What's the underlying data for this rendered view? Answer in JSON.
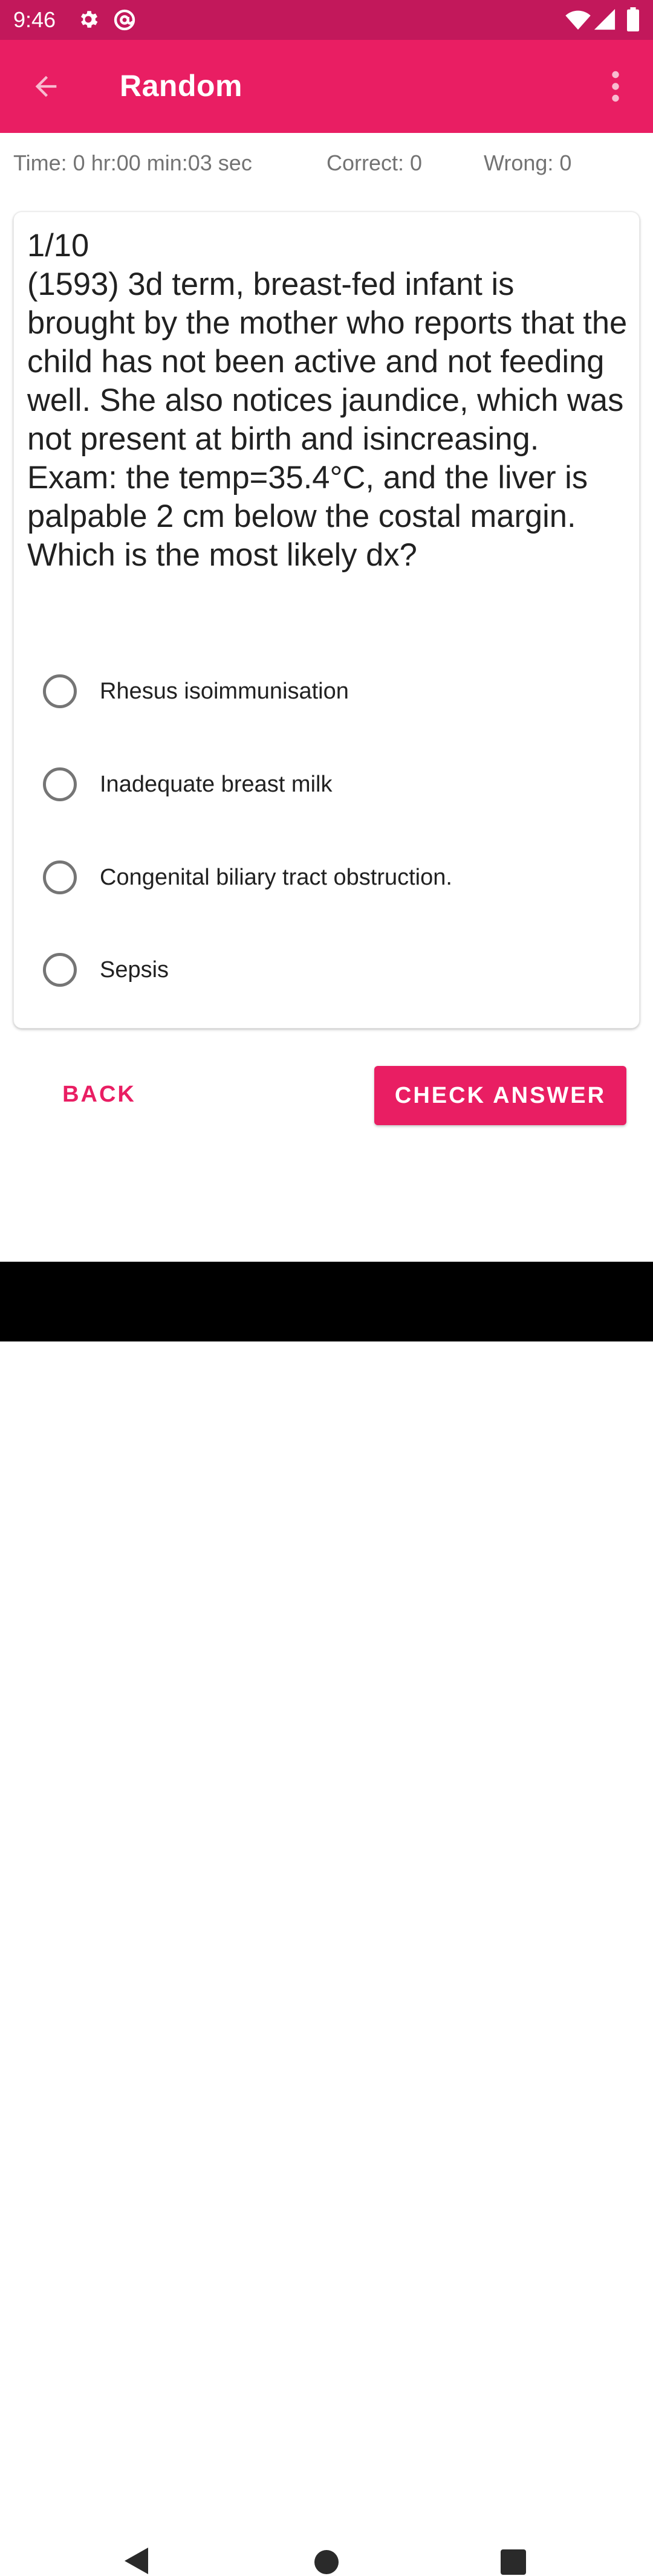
{
  "status_bar": {
    "time": "9:46",
    "icons": [
      "gear-icon",
      "at-sign-icon",
      "wifi-icon",
      "signal-icon",
      "battery-icon"
    ]
  },
  "app_bar": {
    "title": "Random",
    "icons": [
      "back-arrow-icon",
      "overflow-menu-icon"
    ]
  },
  "stats": {
    "time_label": "Time: 0 hr:00 min:03 sec",
    "correct_label": "Correct: 0",
    "wrong_label": "Wrong: 0"
  },
  "question": {
    "counter": "1/10",
    "text": "(1593) 3d term, breast-fed infant is brought by the mother who reports that the child has not been active and not feeding well. She also notices jaundice, which was not present at birth and isincreasing. Exam: the temp=35.4°C, and the liver is palpable 2 cm below the costal margin. Which is the most likely dx?"
  },
  "options": [
    {
      "label": "Rhesus isoimmunisation",
      "selected": false
    },
    {
      "label": "Inadequate breast milk",
      "selected": false
    },
    {
      "label": "Congenital biliary tract obstruction.",
      "selected": false
    },
    {
      "label": "Sepsis",
      "selected": false
    }
  ],
  "actions": {
    "back_label": "BACK",
    "check_label": "CHECK ANSWER"
  },
  "nav_bar": {
    "icons": [
      "nav-back-icon",
      "nav-home-icon",
      "nav-recents-icon"
    ]
  },
  "colors": {
    "status_bar": "#c2185b",
    "primary": "#e91e63",
    "text": "#212121",
    "muted_text": "#737373",
    "radio_border": "#757575"
  }
}
